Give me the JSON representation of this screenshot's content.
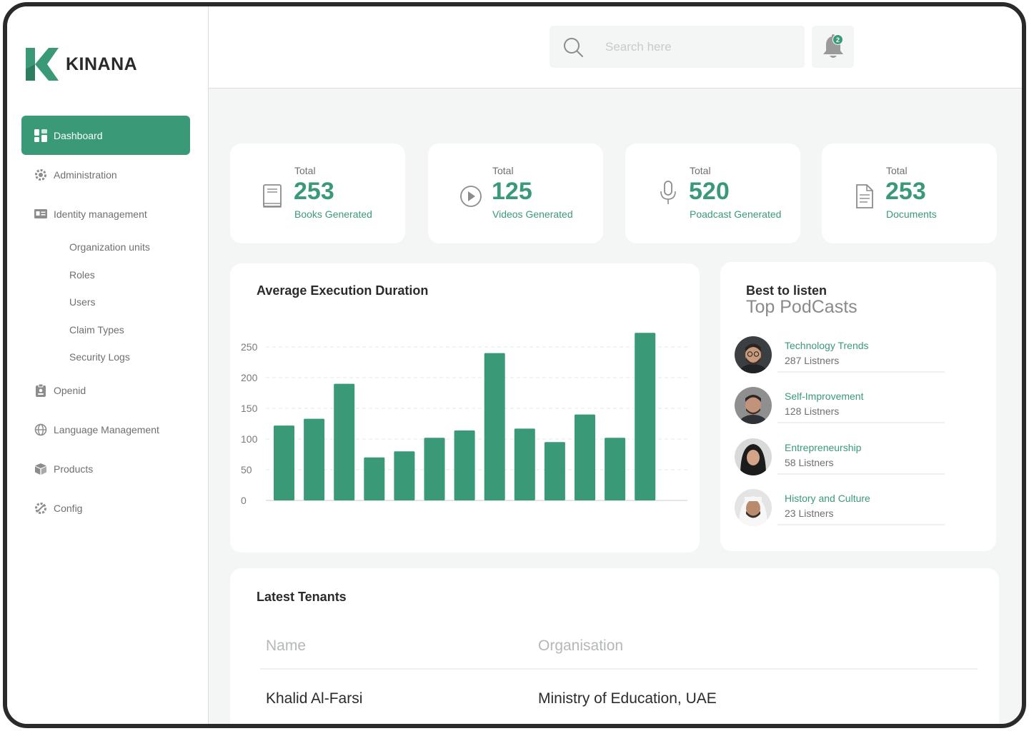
{
  "brand": {
    "name": "KINANA"
  },
  "sidebar": {
    "items": [
      {
        "label": "Dashboard",
        "icon": "dashboard-icon",
        "active": true
      },
      {
        "label": "Administration",
        "icon": "gear-icon"
      },
      {
        "label": "Identity management",
        "icon": "id-card-icon"
      }
    ],
    "subitems": [
      "Organization units",
      "Roles",
      "Users",
      "Claim Types",
      "Security Logs"
    ],
    "items2": [
      {
        "label": "Openid",
        "icon": "badge-icon"
      },
      {
        "label": "Language Management",
        "icon": "globe-icon"
      },
      {
        "label": "Products",
        "icon": "box-icon"
      },
      {
        "label": "Config",
        "icon": "settings-icon"
      }
    ]
  },
  "header": {
    "search_placeholder": "Search here",
    "notification_count": "2"
  },
  "stats": [
    {
      "label": "Total",
      "value": "253",
      "caption": "Books Generated",
      "icon": "book-icon"
    },
    {
      "label": "Total",
      "value": "125",
      "caption": "Videos Generated",
      "icon": "play-icon"
    },
    {
      "label": "Total",
      "value": "520",
      "caption": "Poadcast Generated",
      "icon": "microphone-icon"
    },
    {
      "label": "Total",
      "value": "253",
      "caption": "Documents",
      "icon": "document-icon"
    }
  ],
  "chart": {
    "title": "Average Execution Duration"
  },
  "chart_data": {
    "type": "bar",
    "title": "Average Execution Duration",
    "xlabel": "",
    "ylabel": "",
    "categories": [
      "",
      "",
      "",
      "",
      "",
      "",
      "",
      "",
      "",
      "",
      "",
      "",
      ""
    ],
    "values": [
      122,
      133,
      190,
      70,
      80,
      102,
      114,
      240,
      117,
      95,
      140,
      102,
      273
    ],
    "ylim": [
      0,
      275
    ],
    "yticks": [
      0,
      50,
      100,
      150,
      200,
      250
    ],
    "grid": true,
    "color": "#3a9a78"
  },
  "podcasts": {
    "title": "Best to listen",
    "subtitle": "Top PodCasts",
    "items": [
      {
        "name": "Technology Trends",
        "listeners": "287 Listners"
      },
      {
        "name": "Self-Improvement",
        "listeners": "128 Listners"
      },
      {
        "name": "Entrepreneurship",
        "listeners": "58 Listners"
      },
      {
        "name": "History and Culture",
        "listeners": "23 Listners"
      }
    ]
  },
  "tenants": {
    "title": "Latest Tenants",
    "columns": [
      "Name",
      "Organisation"
    ],
    "rows": [
      [
        "Khalid Al-Farsi",
        "Ministry of Education, UAE"
      ]
    ]
  },
  "colors": {
    "accent": "#3a9a78",
    "background": "#f4f6f5"
  }
}
